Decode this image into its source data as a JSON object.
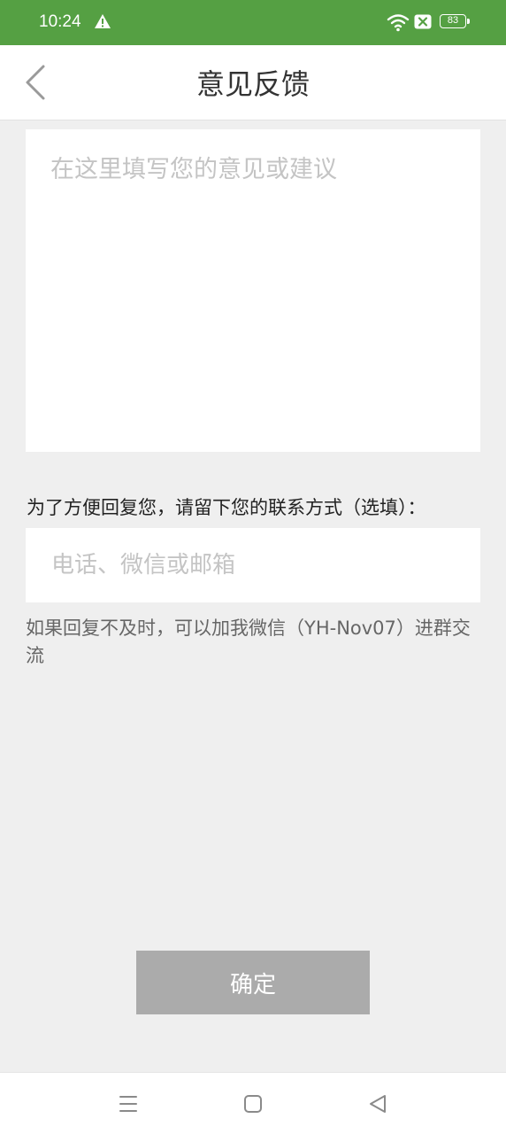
{
  "status_bar": {
    "time": "10:24",
    "battery": "83",
    "icons": [
      "warning-icon",
      "wifi-icon",
      "sim-card-icon",
      "battery-icon"
    ]
  },
  "header": {
    "title": "意见反馈",
    "back_icon": "chevron-left-icon"
  },
  "feedback": {
    "value": "",
    "placeholder": "在这里填写您的意见或建议"
  },
  "contact": {
    "label": "为了方便回复您，请留下您的联系方式（选填）：",
    "value": "",
    "placeholder": "电话、微信或邮箱"
  },
  "tip": "如果回复不及时，可以加我微信（YH-Nov07）进群交流",
  "confirm_label": "确定",
  "nav_bar": {
    "icons": [
      "menu-icon",
      "home-icon",
      "back-icon"
    ]
  },
  "colors": {
    "status_bar": "#55a043",
    "page_background": "#efefef",
    "button_disabled": "#ababab"
  }
}
